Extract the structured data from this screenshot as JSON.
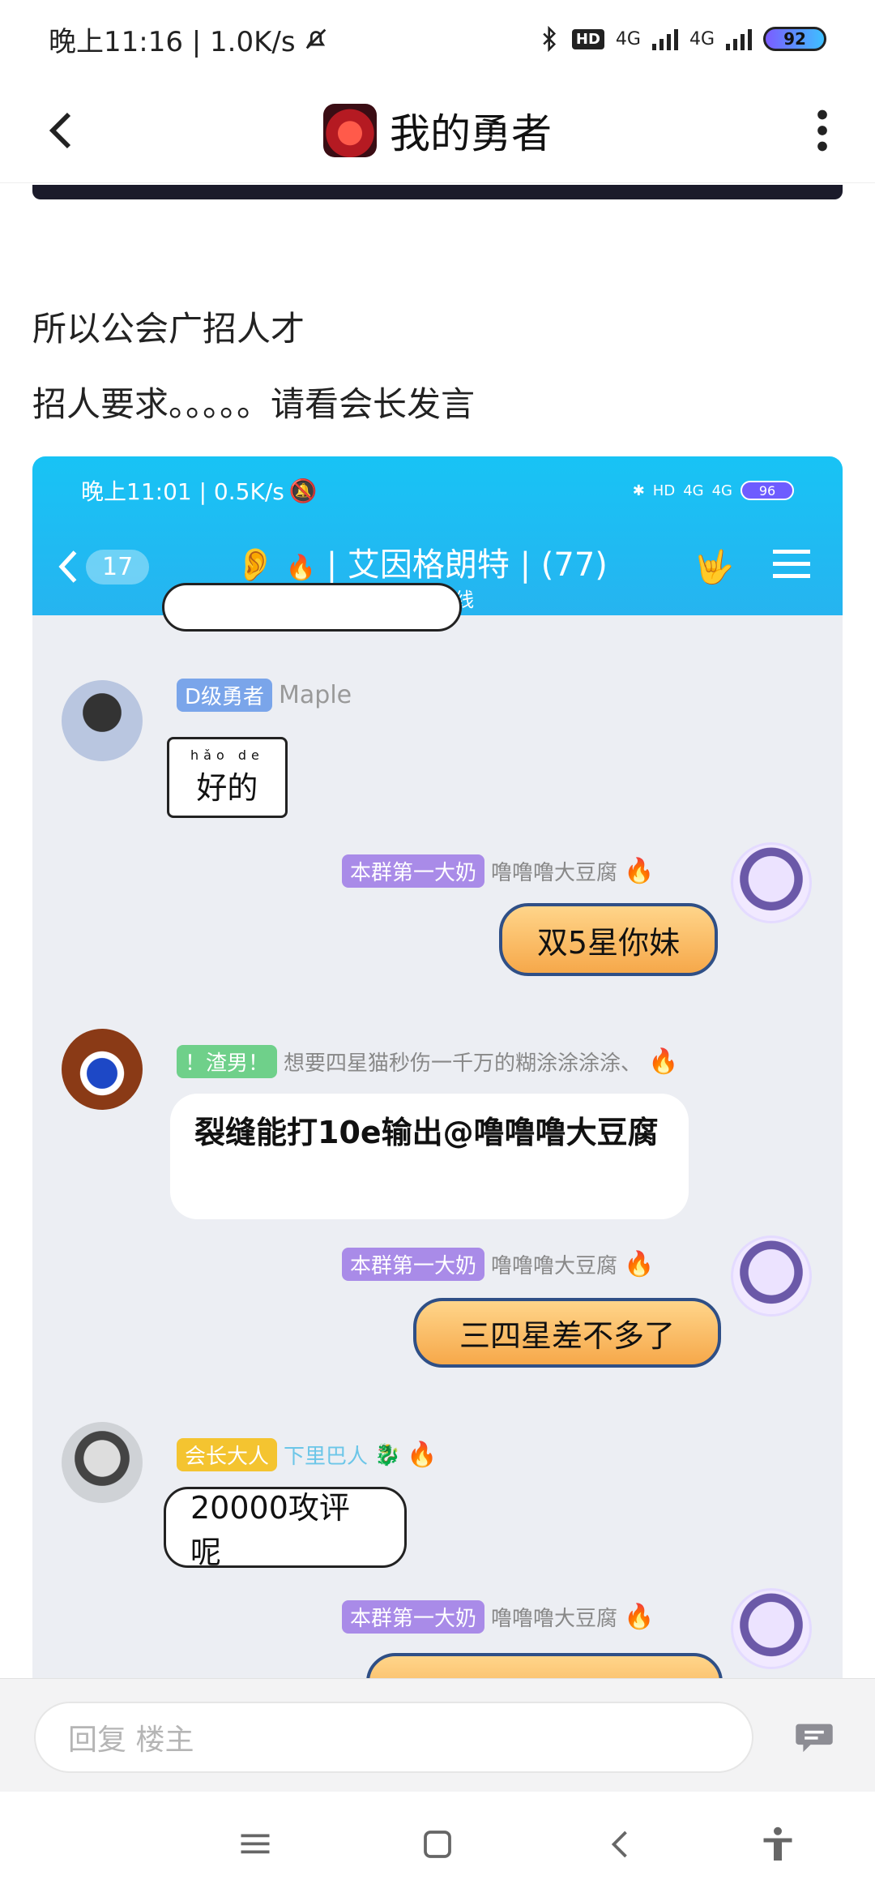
{
  "status_bar": {
    "time_net": "晚上11:16 | 1.0K/s",
    "hd": "HD",
    "net1": "4G",
    "net2": "4G",
    "battery": "92"
  },
  "header": {
    "title": "我的勇者"
  },
  "post": {
    "line1": "所以公会广招人才",
    "line2": "招人要求。。。。。请看会长发言"
  },
  "embedded": {
    "status_time": "晚上11:01 | 0.5K/s",
    "status_hd": "HD",
    "status_net1": "4G",
    "status_net2": "4G",
    "battery": "96",
    "back_count": "17",
    "group_title": "| 艾因格朗特 | (77)",
    "online": "67人在线",
    "messages": [
      {
        "tag": "D级勇者",
        "name": "Maple",
        "text": "好的",
        "pinyin": "hǎo   de"
      },
      {
        "tag": "本群第一大奶",
        "name": "噜噜噜大豆腐",
        "text": "双5星你妹"
      },
      {
        "tag": "！渣男！",
        "name": "想要四星猫秒伤一千万的糊涂涂涂涂、",
        "text": "裂缝能打10e输出@噜噜噜大豆腐"
      },
      {
        "tag": "本群第一大奶",
        "name": "噜噜噜大豆腐",
        "text": "三四星差不多了"
      },
      {
        "tag": "会长大人",
        "name": "下里巴人",
        "text": "20000攻评呢"
      },
      {
        "tag": "本群第一大奶",
        "name": "噜噜噜大豆腐"
      }
    ]
  },
  "reply": {
    "placeholder": "回复  楼主"
  }
}
